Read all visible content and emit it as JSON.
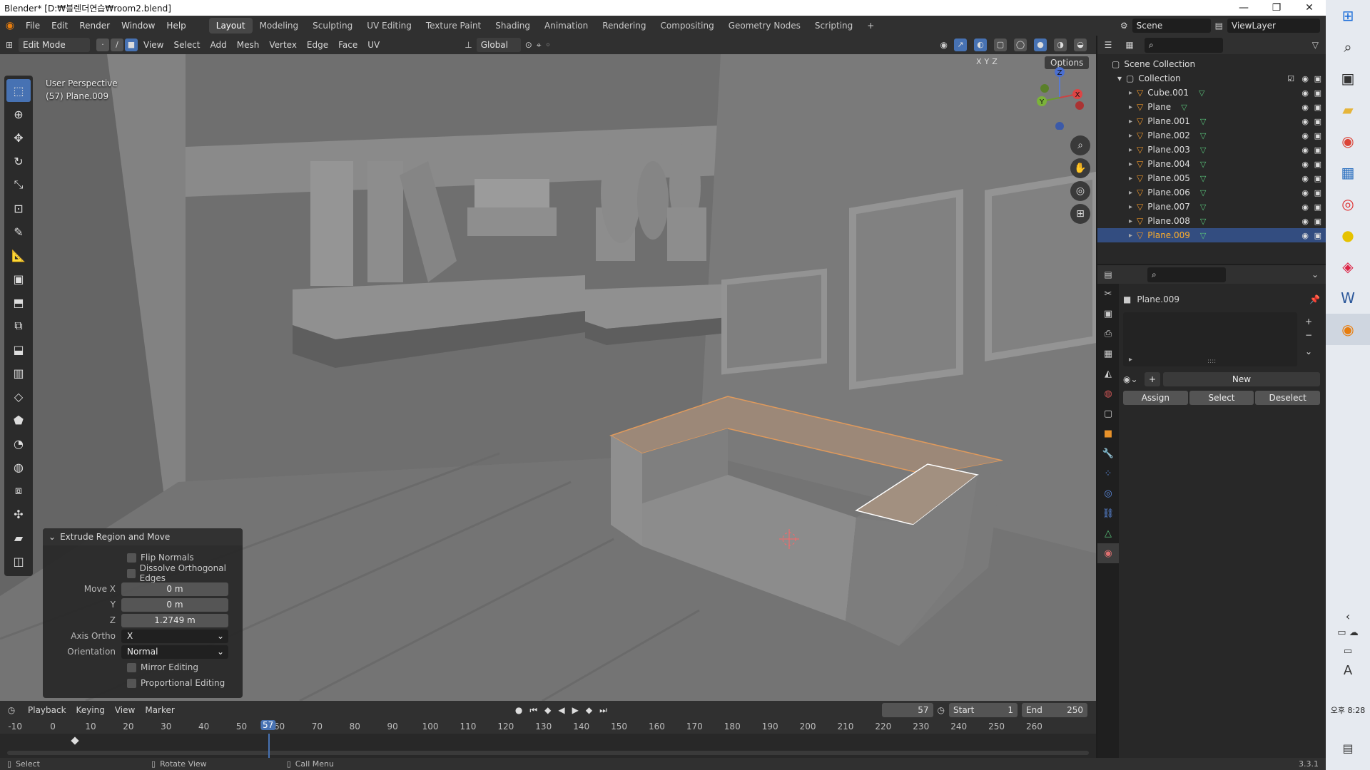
{
  "window": {
    "title": "Blender* [D:₩블렌더연습₩room2.blend]",
    "minimize": "—",
    "restore": "❐",
    "close": "✕"
  },
  "menu": [
    "File",
    "Edit",
    "Render",
    "Window",
    "Help"
  ],
  "workspaces": [
    "Layout",
    "Modeling",
    "Sculpting",
    "UV Editing",
    "Texture Paint",
    "Shading",
    "Animation",
    "Rendering",
    "Compositing",
    "Geometry Nodes",
    "Scripting"
  ],
  "active_workspace": "Layout",
  "add_workspace": "+",
  "scene": {
    "label": "Scene",
    "viewlayer": "ViewLayer"
  },
  "viewport_header": {
    "mode": "Edit Mode",
    "menus": [
      "View",
      "Select",
      "Add",
      "Mesh",
      "Vertex",
      "Edge",
      "Face",
      "UV"
    ],
    "transform_orientation": "Global",
    "options": "Options",
    "axes": [
      "X",
      "Y",
      "Z"
    ]
  },
  "viewport": {
    "perspective": "User Perspective",
    "object": "(57) Plane.009"
  },
  "gizmo": {
    "x": "X",
    "y": "Y",
    "z": "Z"
  },
  "redo_panel": {
    "title": "Extrude Region and Move",
    "flip_normals": "Flip Normals",
    "dissolve": "Dissolve Orthogonal Edges",
    "move_x_label": "Move X",
    "move_x": "0 m",
    "y_label": "Y",
    "y": "0 m",
    "z_label": "Z",
    "z": "1.2749 m",
    "axis_ortho_label": "Axis Ortho",
    "axis_ortho": "X",
    "orientation_label": "Orientation",
    "orientation": "Normal",
    "mirror": "Mirror Editing",
    "proportional": "Proportional Editing"
  },
  "timeline": {
    "menus": [
      "Playback",
      "Keying",
      "View",
      "Marker"
    ],
    "current_frame": "57",
    "start_label": "Start",
    "start": "1",
    "end_label": "End",
    "end": "250",
    "ticks": [
      "-10",
      "0",
      "10",
      "20",
      "30",
      "40",
      "50",
      "60",
      "70",
      "80",
      "90",
      "100",
      "110",
      "120",
      "130",
      "140",
      "150",
      "160",
      "170",
      "180",
      "190",
      "200",
      "210",
      "220",
      "230",
      "240",
      "250",
      "260"
    ],
    "playhead": "57"
  },
  "outliner": {
    "scene_collection": "Scene Collection",
    "collection": "Collection",
    "items": [
      "Cube.001",
      "Plane",
      "Plane.001",
      "Plane.002",
      "Plane.003",
      "Plane.004",
      "Plane.005",
      "Plane.006",
      "Plane.007",
      "Plane.008",
      "Plane.009"
    ],
    "selected": "Plane.009"
  },
  "properties": {
    "object": "Plane.009",
    "new": "New",
    "assign": "Assign",
    "select": "Select",
    "deselect": "Deselect",
    "dots": "::::",
    "plus": "+",
    "minus": "−",
    "chevron": "⌄"
  },
  "statusbar": {
    "select": "Select",
    "rotate": "Rotate View",
    "menu": "Call Menu",
    "version": "3.3.1"
  },
  "taskbar": {
    "time_period": "오후",
    "time": "8:28",
    "letter": "A"
  }
}
